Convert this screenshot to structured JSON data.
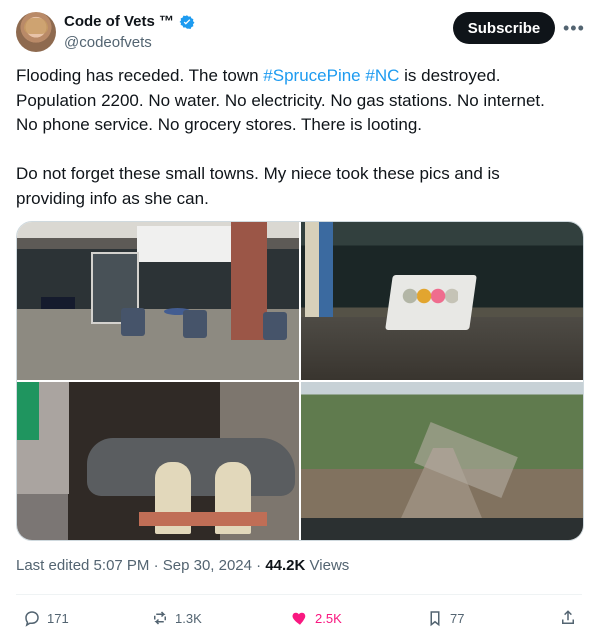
{
  "author": {
    "name": "Code of Vets ™",
    "handle": "@codeofvets"
  },
  "actions": {
    "subscribe_label": "Subscribe"
  },
  "tweet": {
    "line1_prefix": "Flooding has receded. The town ",
    "hashtag1": "#SprucePine",
    "hashtag2": "#NC",
    "line1_suffix": " is destroyed.",
    "line2": "Population 2200. No water. No electricity. No gas stations. No internet.",
    "line3": "No phone service. No grocery stores. There is looting.",
    "line4": "Do not forget these small towns. My niece took these pics and is",
    "line5": "providing info as she can."
  },
  "metadata": {
    "edited": "Last edited 5:07 PM · Sep 30, 2024 · ",
    "views_count": "44.2K",
    "views_label": "Views"
  },
  "stats": {
    "replies": "171",
    "reposts": "1.3K",
    "likes": "2.5K",
    "bookmarks": "77"
  },
  "colors": {
    "accent": "#1d9bf0",
    "like": "#f91880",
    "text": "#0f1419",
    "secondary": "#536471"
  },
  "icons": {
    "verified": "verified-badge-icon",
    "more": "more-horizontal-icon",
    "reply": "reply-icon",
    "repost": "repost-icon",
    "like": "heart-icon",
    "bookmark": "bookmark-icon",
    "share": "share-icon"
  }
}
